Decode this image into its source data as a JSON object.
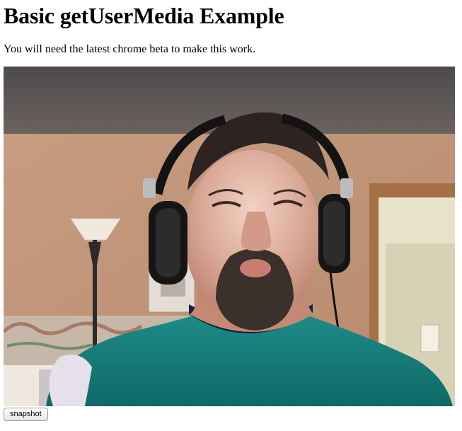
{
  "page": {
    "title": "Basic getUserMedia Example",
    "subtitle": "You will need the latest chrome beta to make this work."
  },
  "video": {
    "content": "webcam-feed"
  },
  "controls": {
    "snapshot_label": "snapshot"
  }
}
